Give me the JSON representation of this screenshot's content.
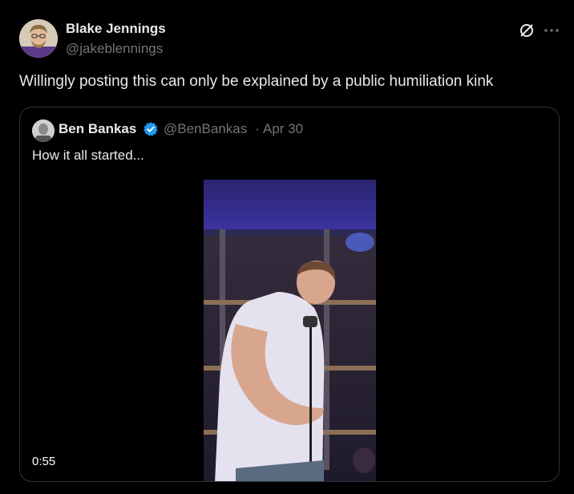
{
  "author": {
    "name": "Blake Jennings",
    "handle": "@jakeblennings",
    "avatar_icon": "profile-avatar"
  },
  "actions": {
    "grok_icon": "grok-icon",
    "more_icon": "more-icon"
  },
  "tweet": {
    "text": "Willingly posting this can only be explained by a public humiliation kink"
  },
  "quote": {
    "author_name": "Ben Bankas",
    "verified_icon": "verified-badge-icon",
    "handle": "@BenBankas",
    "separator": "·",
    "date": "Apr 30",
    "text": "How it all started...",
    "video": {
      "duration": "0:55"
    }
  },
  "colors": {
    "background": "#000000",
    "text_primary": "#e7e9ea",
    "text_secondary": "#71767b",
    "border": "#2f3336",
    "verified_blue": "#1d9bf0"
  }
}
